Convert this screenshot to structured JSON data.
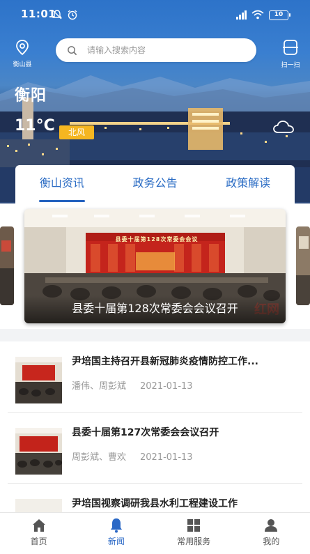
{
  "status_bar": {
    "time": "11:01",
    "battery": "10"
  },
  "header": {
    "location_label": "衡山县",
    "search_placeholder": "请输入搜索内容",
    "scan_label": "扫一扫"
  },
  "weather": {
    "city": "衡阳",
    "temperature": "11°C",
    "wind": "北风"
  },
  "tabs": [
    {
      "label": "衡山资讯",
      "active": true
    },
    {
      "label": "政务公告",
      "active": false
    },
    {
      "label": "政策解读",
      "active": false
    }
  ],
  "carousel": {
    "caption": "县委十届第128次常委会会议召开",
    "banner_text": "县委十届第128次常委会会议"
  },
  "news": [
    {
      "title": "尹培国主持召开县新冠肺炎疫情防控工作...",
      "authors": "潘伟、周彭斌",
      "date": "2021-01-13"
    },
    {
      "title": "县委十届第127次常委会会议召开",
      "authors": "周彭斌、曹欢",
      "date": "2021-01-13"
    },
    {
      "title": "尹培国视察调研我县水利工程建设工作"
    }
  ],
  "bottom_nav": [
    {
      "label": "首页",
      "icon": "home-icon",
      "active": false
    },
    {
      "label": "新闻",
      "icon": "bell-icon",
      "active": true
    },
    {
      "label": "常用服务",
      "icon": "grid-icon",
      "active": false
    },
    {
      "label": "我的",
      "icon": "user-icon",
      "active": false
    }
  ],
  "colors": {
    "accent": "#2a68c6",
    "badge": "#f5b621",
    "header_top": "#2d73c9"
  }
}
